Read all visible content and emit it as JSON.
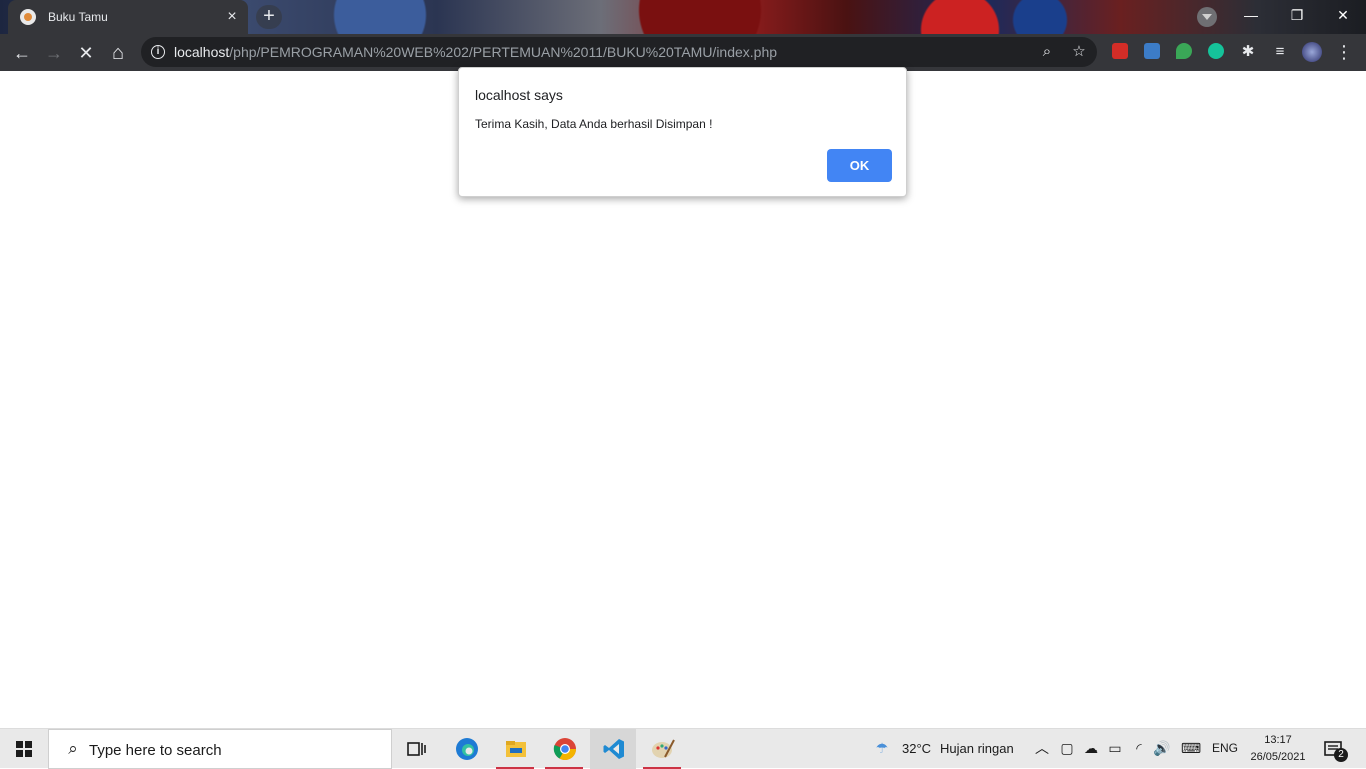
{
  "browser": {
    "tab": {
      "title": "Buku Tamu",
      "close_icon": "×"
    },
    "new_tab_icon": "+",
    "window_controls": {
      "minimize": "—",
      "restore": "❐",
      "close": "✕"
    },
    "nav": {
      "back": "←",
      "forward": "→",
      "reload": "✕",
      "home": "⌂"
    },
    "address": {
      "info_icon": "i",
      "host": "localhost",
      "path": "/php/PEMROGRAMAN%20WEB%202/PERTEMUAN%2011/BUKU%20TAMU/index.php",
      "zoom_icon": "⌕",
      "star_icon": "☆"
    },
    "menu_icon": "⋮",
    "extensions": [
      {
        "name": "lastpass-icon",
        "color": "#d32d27"
      },
      {
        "name": "s-extension-icon",
        "color": "#3c7cc7"
      },
      {
        "name": "green-extension-icon",
        "color": "#3aa757"
      },
      {
        "name": "grammarly-icon",
        "color": "#15c39a"
      }
    ],
    "accent": "#4285f4"
  },
  "dialog": {
    "title": "localhost says",
    "message": "Terima Kasih, Data Anda berhasil Disimpan !",
    "ok_label": "OK"
  },
  "taskbar": {
    "search_placeholder": "Type here to search",
    "weather": {
      "temp": "32°C",
      "desc": "Hujan ringan"
    },
    "language": "ENG",
    "time": "13:17",
    "date": "26/05/2021",
    "notification_count": "2",
    "apps": [
      {
        "name": "task-view-icon"
      },
      {
        "name": "edge-icon"
      },
      {
        "name": "file-explorer-icon"
      },
      {
        "name": "chrome-icon"
      },
      {
        "name": "vscode-icon"
      },
      {
        "name": "paint-icon"
      }
    ]
  }
}
